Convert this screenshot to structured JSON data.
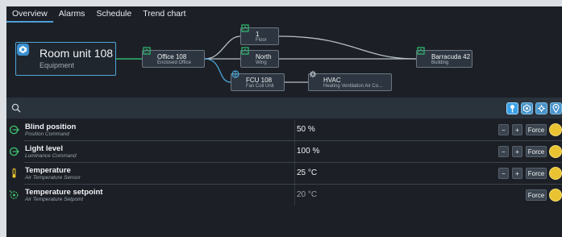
{
  "tabs": [
    {
      "label": "Overview",
      "active": true
    },
    {
      "label": "Alarms",
      "active": false
    },
    {
      "label": "Schedule",
      "active": false
    },
    {
      "label": "Trend chart",
      "active": false
    }
  ],
  "graph": {
    "main": {
      "title": "Room unit 108",
      "subtitle": "Equipment",
      "icon": "equipment-icon"
    },
    "office": {
      "title": "Office 108",
      "subtitle": "Enclosed Office",
      "icon": "location-icon"
    },
    "floor": {
      "title": "1",
      "subtitle": "Floor",
      "icon": "location-icon"
    },
    "wing": {
      "title": "North",
      "subtitle": "Wing",
      "icon": "location-icon"
    },
    "fcu": {
      "title": "FCU 108",
      "subtitle": "Fan Coil Unit",
      "icon": "fan-coil-icon"
    },
    "hvac": {
      "title": "HVAC",
      "subtitle": "Heating Ventilation Air Co...",
      "icon": "gear-icon"
    },
    "building": {
      "title": "Barracuda 42",
      "subtitle": "Building",
      "icon": "building-icon"
    },
    "colors": {
      "location_link": "#2fb56f",
      "equipment_link": "#4aa6d6",
      "neutral_link": "#b7bec6"
    }
  },
  "toolbar": {
    "buttons": [
      "location-pin-icon",
      "equipment-icon",
      "point-icon",
      "map-pin-icon"
    ]
  },
  "points": [
    {
      "name": "Blind position",
      "type": "Position Command",
      "value": "50 %",
      "icon": "command-icon",
      "stepper": true,
      "force_label": "Force",
      "minus": "−",
      "plus": "+",
      "dim": false
    },
    {
      "name": "Light level",
      "type": "Luminance Command",
      "value": "100 %",
      "icon": "command-icon",
      "stepper": true,
      "force_label": "Force",
      "minus": "−",
      "plus": "+",
      "dim": false
    },
    {
      "name": "Temperature",
      "type": "Air Temperature Sensor",
      "value": "25 °C",
      "icon": "thermometer-icon",
      "stepper": true,
      "force_label": "Force",
      "minus": "−",
      "plus": "+",
      "dim": false
    },
    {
      "name": "Temperature setpoint",
      "type": "Air Temperature Setpoint",
      "value": "20 °C",
      "icon": "setpoint-icon",
      "stepper": false,
      "force_label": "Force",
      "dim": true
    }
  ],
  "colors": {
    "accent": "#4b9fd8",
    "background": "#1c2026",
    "toolbar": "#2a323b",
    "override_button": "#e9c331",
    "point_icon": "#3fc06f",
    "thermometer": "#e9c331"
  }
}
